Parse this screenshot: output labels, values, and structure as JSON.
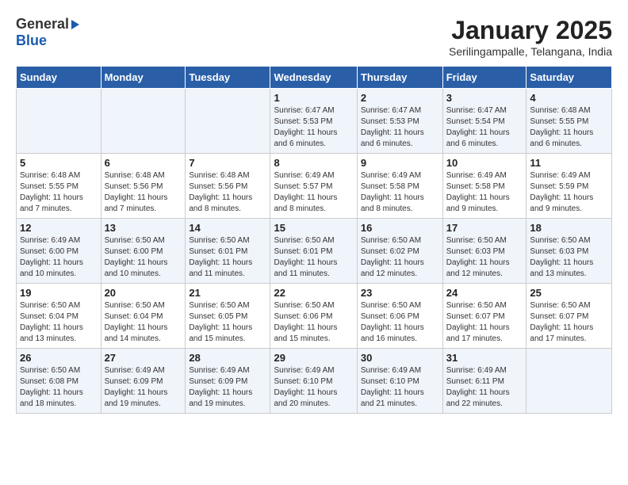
{
  "logo": {
    "general": "General",
    "blue": "Blue"
  },
  "title": "January 2025",
  "subtitle": "Serilingampalle, Telangana, India",
  "days_header": [
    "Sunday",
    "Monday",
    "Tuesday",
    "Wednesday",
    "Thursday",
    "Friday",
    "Saturday"
  ],
  "weeks": [
    [
      {
        "day": "",
        "info": ""
      },
      {
        "day": "",
        "info": ""
      },
      {
        "day": "",
        "info": ""
      },
      {
        "day": "1",
        "info": "Sunrise: 6:47 AM\nSunset: 5:53 PM\nDaylight: 11 hours\nand 6 minutes."
      },
      {
        "day": "2",
        "info": "Sunrise: 6:47 AM\nSunset: 5:53 PM\nDaylight: 11 hours\nand 6 minutes."
      },
      {
        "day": "3",
        "info": "Sunrise: 6:47 AM\nSunset: 5:54 PM\nDaylight: 11 hours\nand 6 minutes."
      },
      {
        "day": "4",
        "info": "Sunrise: 6:48 AM\nSunset: 5:55 PM\nDaylight: 11 hours\nand 6 minutes."
      }
    ],
    [
      {
        "day": "5",
        "info": "Sunrise: 6:48 AM\nSunset: 5:55 PM\nDaylight: 11 hours\nand 7 minutes."
      },
      {
        "day": "6",
        "info": "Sunrise: 6:48 AM\nSunset: 5:56 PM\nDaylight: 11 hours\nand 7 minutes."
      },
      {
        "day": "7",
        "info": "Sunrise: 6:48 AM\nSunset: 5:56 PM\nDaylight: 11 hours\nand 8 minutes."
      },
      {
        "day": "8",
        "info": "Sunrise: 6:49 AM\nSunset: 5:57 PM\nDaylight: 11 hours\nand 8 minutes."
      },
      {
        "day": "9",
        "info": "Sunrise: 6:49 AM\nSunset: 5:58 PM\nDaylight: 11 hours\nand 8 minutes."
      },
      {
        "day": "10",
        "info": "Sunrise: 6:49 AM\nSunset: 5:58 PM\nDaylight: 11 hours\nand 9 minutes."
      },
      {
        "day": "11",
        "info": "Sunrise: 6:49 AM\nSunset: 5:59 PM\nDaylight: 11 hours\nand 9 minutes."
      }
    ],
    [
      {
        "day": "12",
        "info": "Sunrise: 6:49 AM\nSunset: 6:00 PM\nDaylight: 11 hours\nand 10 minutes."
      },
      {
        "day": "13",
        "info": "Sunrise: 6:50 AM\nSunset: 6:00 PM\nDaylight: 11 hours\nand 10 minutes."
      },
      {
        "day": "14",
        "info": "Sunrise: 6:50 AM\nSunset: 6:01 PM\nDaylight: 11 hours\nand 11 minutes."
      },
      {
        "day": "15",
        "info": "Sunrise: 6:50 AM\nSunset: 6:01 PM\nDaylight: 11 hours\nand 11 minutes."
      },
      {
        "day": "16",
        "info": "Sunrise: 6:50 AM\nSunset: 6:02 PM\nDaylight: 11 hours\nand 12 minutes."
      },
      {
        "day": "17",
        "info": "Sunrise: 6:50 AM\nSunset: 6:03 PM\nDaylight: 11 hours\nand 12 minutes."
      },
      {
        "day": "18",
        "info": "Sunrise: 6:50 AM\nSunset: 6:03 PM\nDaylight: 11 hours\nand 13 minutes."
      }
    ],
    [
      {
        "day": "19",
        "info": "Sunrise: 6:50 AM\nSunset: 6:04 PM\nDaylight: 11 hours\nand 13 minutes."
      },
      {
        "day": "20",
        "info": "Sunrise: 6:50 AM\nSunset: 6:04 PM\nDaylight: 11 hours\nand 14 minutes."
      },
      {
        "day": "21",
        "info": "Sunrise: 6:50 AM\nSunset: 6:05 PM\nDaylight: 11 hours\nand 15 minutes."
      },
      {
        "day": "22",
        "info": "Sunrise: 6:50 AM\nSunset: 6:06 PM\nDaylight: 11 hours\nand 15 minutes."
      },
      {
        "day": "23",
        "info": "Sunrise: 6:50 AM\nSunset: 6:06 PM\nDaylight: 11 hours\nand 16 minutes."
      },
      {
        "day": "24",
        "info": "Sunrise: 6:50 AM\nSunset: 6:07 PM\nDaylight: 11 hours\nand 17 minutes."
      },
      {
        "day": "25",
        "info": "Sunrise: 6:50 AM\nSunset: 6:07 PM\nDaylight: 11 hours\nand 17 minutes."
      }
    ],
    [
      {
        "day": "26",
        "info": "Sunrise: 6:50 AM\nSunset: 6:08 PM\nDaylight: 11 hours\nand 18 minutes."
      },
      {
        "day": "27",
        "info": "Sunrise: 6:49 AM\nSunset: 6:09 PM\nDaylight: 11 hours\nand 19 minutes."
      },
      {
        "day": "28",
        "info": "Sunrise: 6:49 AM\nSunset: 6:09 PM\nDaylight: 11 hours\nand 19 minutes."
      },
      {
        "day": "29",
        "info": "Sunrise: 6:49 AM\nSunset: 6:10 PM\nDaylight: 11 hours\nand 20 minutes."
      },
      {
        "day": "30",
        "info": "Sunrise: 6:49 AM\nSunset: 6:10 PM\nDaylight: 11 hours\nand 21 minutes."
      },
      {
        "day": "31",
        "info": "Sunrise: 6:49 AM\nSunset: 6:11 PM\nDaylight: 11 hours\nand 22 minutes."
      },
      {
        "day": "",
        "info": ""
      }
    ]
  ]
}
